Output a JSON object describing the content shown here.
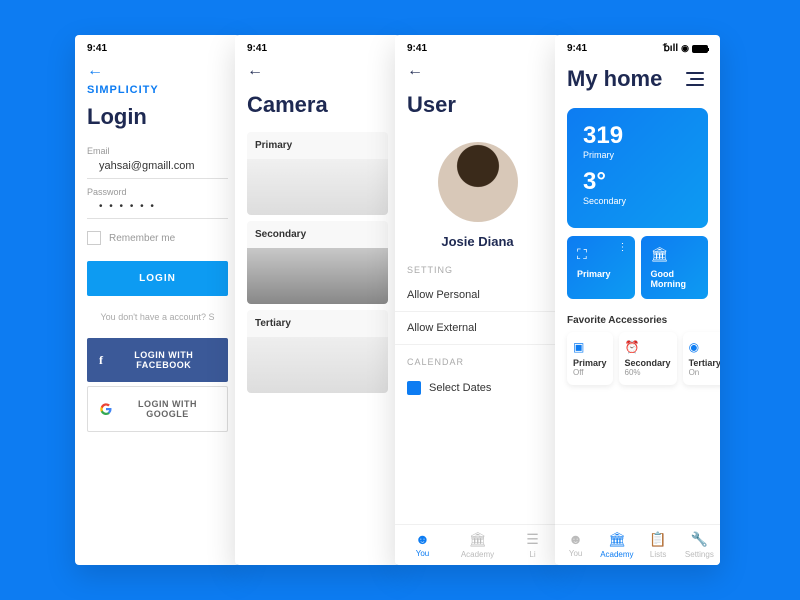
{
  "status_time": "9:41",
  "screen1": {
    "brand": "SIMPLICITY",
    "title": "Login",
    "email_label": "Email",
    "email_value": "yahsai@gmaill.com",
    "password_label": "Password",
    "password_value": "• • • • • •",
    "remember_label": "Remember me",
    "login_btn": "LOGIN",
    "no_account": "You don't have a account? S",
    "fb_btn": "LOGIN WITH FACEBOOK",
    "google_btn": "LOGIN WITH GOOGLE"
  },
  "screen2": {
    "title": "Camera",
    "cards": [
      "Primary",
      "Secondary",
      "Tertiary"
    ]
  },
  "screen3": {
    "title": "User",
    "name": "Josie Diana",
    "setting_label": "SETTING",
    "allow_personal": "Allow Personal",
    "allow_external": "Allow External",
    "calendar_label": "CALENDAR",
    "select_dates": "Select Dates",
    "tabs": [
      "You",
      "Academy",
      "Li"
    ]
  },
  "screen4": {
    "title": "My home",
    "big_num1": "319",
    "big_sub1": "Primary",
    "big_num2": "3°",
    "big_sub2": "Secondary",
    "tile1": "Primary",
    "tile2": "Good Morning",
    "fav_label": "Favorite Accessories",
    "favs": [
      {
        "title": "Primary",
        "sub": "Off"
      },
      {
        "title": "Secondary",
        "sub": "60%"
      },
      {
        "title": "Tertiary",
        "sub": "On"
      }
    ],
    "tabs": [
      "You",
      "Academy",
      "Lists",
      "Settings"
    ]
  }
}
